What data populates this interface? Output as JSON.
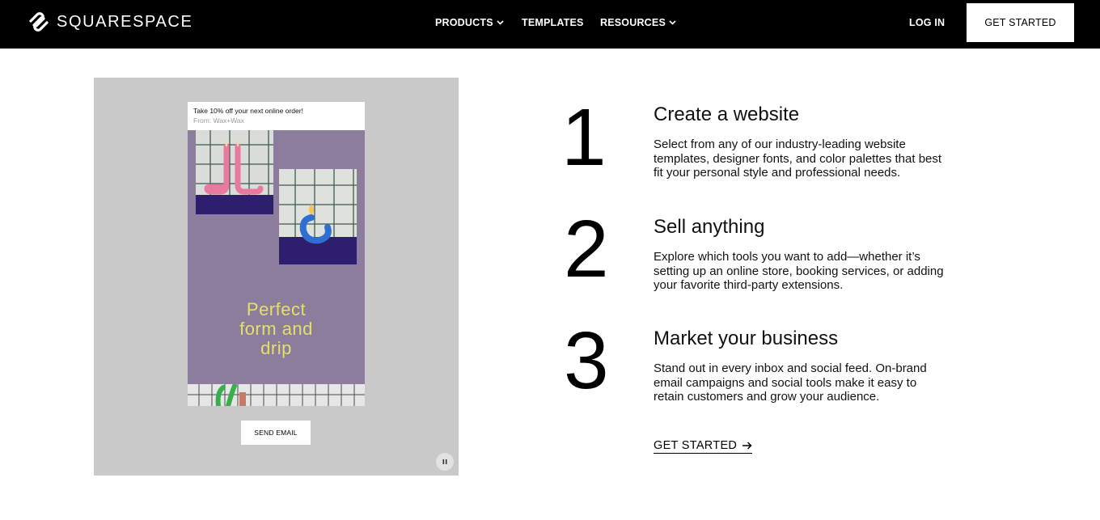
{
  "header": {
    "brand": "SQUARESPACE",
    "nav": {
      "products": "PRODUCTS",
      "templates": "TEMPLATES",
      "resources": "RESOURCES",
      "login": "LOG IN"
    },
    "get_started": "GET STARTED"
  },
  "demo": {
    "email_subject": "Take 10% off your next online order!",
    "email_from": "From: Wax+Wax",
    "headline_lines": [
      "Perfect",
      "form and",
      "drip"
    ],
    "send_email": "SEND EMAIL"
  },
  "steps": [
    {
      "number": "1",
      "title": "Create a website",
      "desc_lines": [
        "Select from any of our industry-leading website",
        "templates, designer fonts, and color palettes that best",
        "fit your personal style and professional needs."
      ]
    },
    {
      "number": "2",
      "title": "Sell anything",
      "desc_lines": [
        "Explore which tools you want to add—whether it’s",
        "setting up an online store, booking services, or adding",
        "your favorite third-party extensions."
      ]
    },
    {
      "number": "3",
      "title": "Market your business",
      "desc_lines": [
        "Stand out in every inbox and social feed. On-brand",
        "email campaigns and social tools make it easy to",
        "retain customers and grow your audience."
      ]
    }
  ],
  "cta": "GET STARTED",
  "colors": {
    "header_bg": "#000000",
    "panel_bg": "#c9c9c9",
    "email_body": "#8d7d9c",
    "headline": "#e3e06a",
    "candle_pink": "#e87aa0",
    "candle_blue": "#2f6fd1",
    "pedestal": "#2e1f6e"
  }
}
